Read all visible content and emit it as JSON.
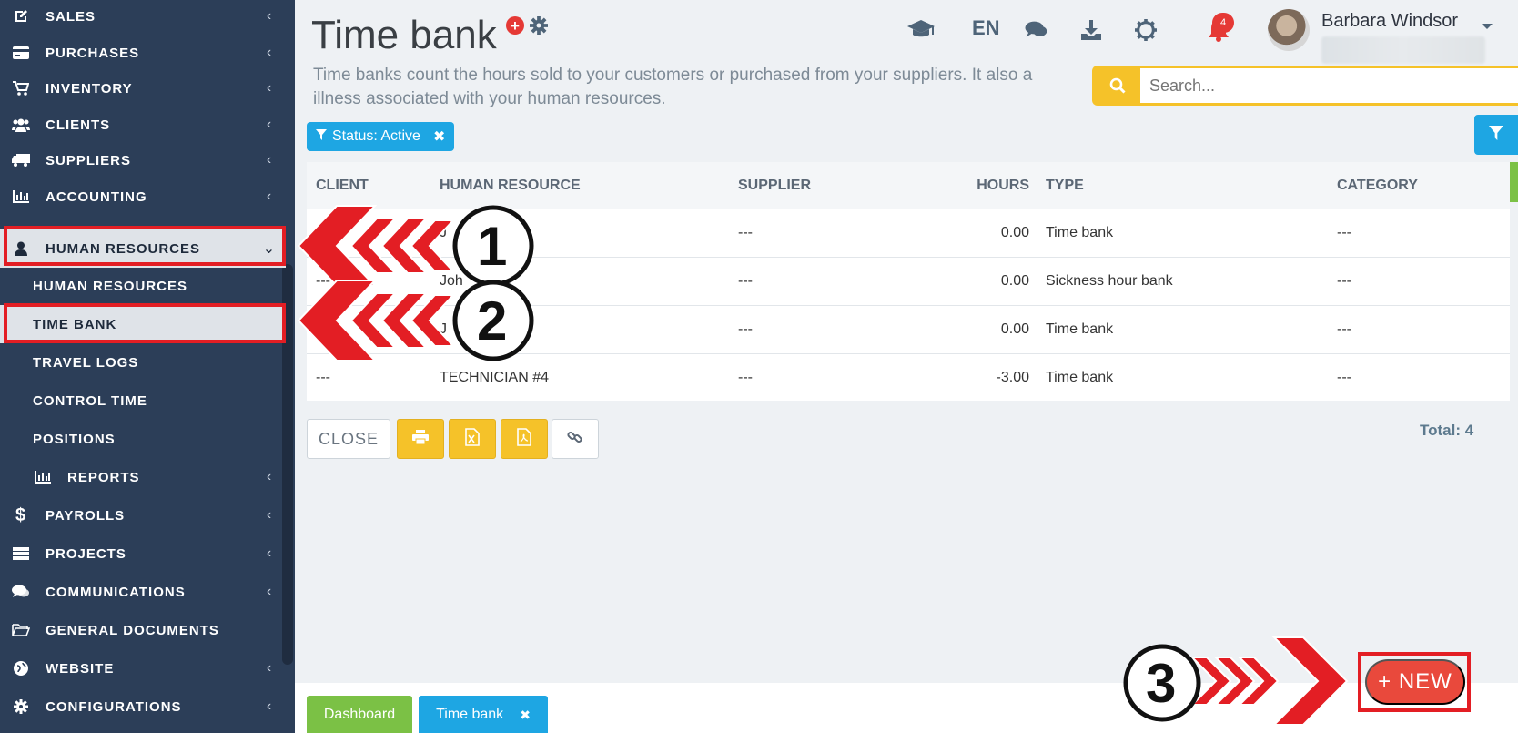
{
  "sidebar": {
    "items": [
      {
        "label": "SALES",
        "icon": "edit-icon"
      },
      {
        "label": "PURCHASES",
        "icon": "credit-card-icon"
      },
      {
        "label": "INVENTORY",
        "icon": "cart-icon"
      },
      {
        "label": "CLIENTS",
        "icon": "users-icon"
      },
      {
        "label": "SUPPLIERS",
        "icon": "truck-icon"
      },
      {
        "label": "ACCOUNTING",
        "icon": "bar-chart-icon"
      },
      {
        "label": "HUMAN RESOURCES",
        "icon": "user-icon"
      },
      {
        "label": "HUMAN RESOURCES"
      },
      {
        "label": "TIME BANK"
      },
      {
        "label": "TRAVEL LOGS"
      },
      {
        "label": "CONTROL TIME"
      },
      {
        "label": "POSITIONS"
      },
      {
        "label": "REPORTS",
        "icon": "bar-chart-icon"
      },
      {
        "label": "PAYROLLS",
        "icon": "dollar-icon"
      },
      {
        "label": "PROJECTS",
        "icon": "server-icon"
      },
      {
        "label": "COMMUNICATIONS",
        "icon": "comments-icon"
      },
      {
        "label": "GENERAL DOCUMENTS",
        "icon": "folder-open-icon"
      },
      {
        "label": "WEBSITE",
        "icon": "globe-icon"
      },
      {
        "label": "CONFIGURATIONS",
        "icon": "gear-icon"
      }
    ],
    "chevron_left": "‹",
    "chevron_down": "⌄"
  },
  "header": {
    "title": "Time bank",
    "plus_glyph": "+",
    "subtitle_line1": "Time banks count the hours sold to your customers or purchased from your suppliers. It also a",
    "subtitle_line2": "illness associated with your human resources.",
    "language": "EN",
    "notifications_count": "4",
    "user_name": "Barbara Windsor"
  },
  "search": {
    "placeholder": "Search..."
  },
  "filter": {
    "label": "Status: Active",
    "remove": "✖"
  },
  "table": {
    "headers": [
      "CLIENT",
      "HUMAN RESOURCE",
      "SUPPLIER",
      "HOURS",
      "TYPE",
      "CATEGORY"
    ],
    "rows": [
      [
        "",
        "J",
        "---",
        "0.00",
        "Time bank",
        "---"
      ],
      [
        "---",
        "Joh",
        "---",
        "0.00",
        "Sickness hour bank",
        "---"
      ],
      [
        "",
        "J",
        "---",
        "0.00",
        "Time bank",
        "---"
      ],
      [
        "---",
        "TECHNICIAN #4",
        "---",
        "-3.00",
        "Time bank",
        "---"
      ]
    ]
  },
  "actions": {
    "close_label": "CLOSE",
    "total_label": "Total: 4"
  },
  "tabs": {
    "dashboard": "Dashboard",
    "timebank": "Time bank",
    "close": "✖"
  },
  "new_button": {
    "label": "+ NEW"
  },
  "annotations": {
    "n1": "1",
    "n2": "2",
    "n3": "3"
  },
  "colors": {
    "sidebar_bg": "#2c3e58",
    "accent_blue": "#1ea6e3",
    "accent_yellow": "#f5c229",
    "accent_green": "#7bc145",
    "highlight_red": "#e31e24",
    "new_button": "#e9493c"
  }
}
